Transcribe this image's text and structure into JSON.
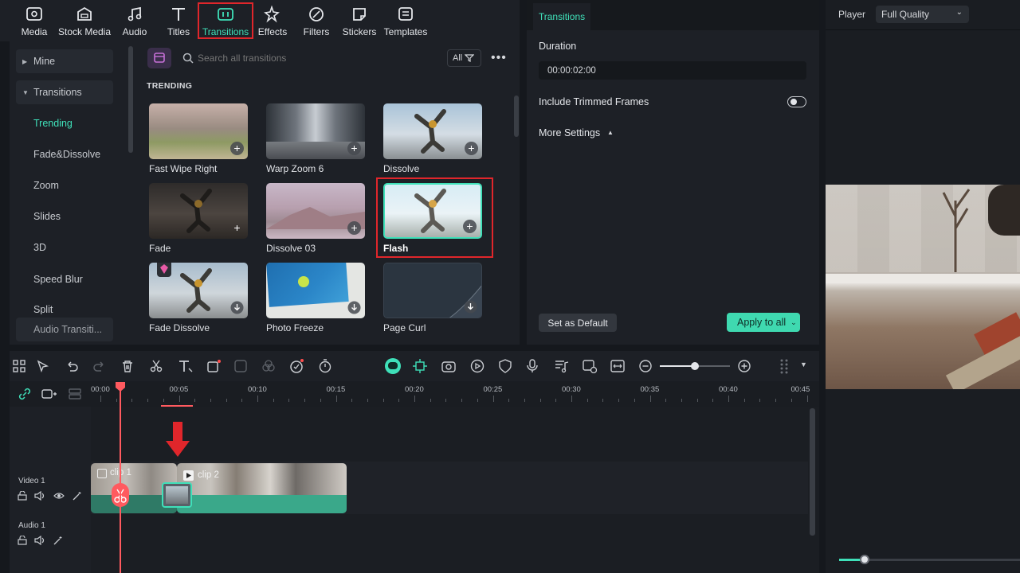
{
  "toolbar": {
    "items": [
      {
        "label": "Media",
        "icon": "media-icon"
      },
      {
        "label": "Stock Media",
        "icon": "stock-media-icon"
      },
      {
        "label": "Audio",
        "icon": "audio-icon"
      },
      {
        "label": "Titles",
        "icon": "titles-icon"
      },
      {
        "label": "Transitions",
        "icon": "transitions-icon",
        "active": true
      },
      {
        "label": "Effects",
        "icon": "effects-icon"
      },
      {
        "label": "Filters",
        "icon": "filters-icon"
      },
      {
        "label": "Stickers",
        "icon": "stickers-icon"
      },
      {
        "label": "Templates",
        "icon": "templates-icon"
      }
    ]
  },
  "sidebar": {
    "mine": "Mine",
    "transitions": "Transitions",
    "items": [
      "Trending",
      "Fade&Dissolve",
      "Zoom",
      "Slides",
      "3D",
      "Speed Blur",
      "Split",
      "Audio Transiti..."
    ]
  },
  "browser": {
    "search_placeholder": "Search all transitions",
    "filter_label": "All",
    "section_title": "TRENDING",
    "items": [
      {
        "label": "Fast Wipe Right"
      },
      {
        "label": "Warp Zoom 6"
      },
      {
        "label": "Dissolve"
      },
      {
        "label": "Fade"
      },
      {
        "label": "Dissolve 03"
      },
      {
        "label": "Flash"
      },
      {
        "label": "Fade Dissolve"
      },
      {
        "label": "Photo Freeze"
      },
      {
        "label": "Page Curl"
      }
    ]
  },
  "properties": {
    "tab": "Transitions",
    "duration_label": "Duration",
    "duration_value": "00:00:02:00",
    "trimmed_label": "Include Trimmed Frames",
    "more_settings": "More Settings",
    "set_default": "Set as Default",
    "apply_all": "Apply to all"
  },
  "player": {
    "label": "Player",
    "quality": "Full Quality"
  },
  "timeline": {
    "ticks": [
      "00:00",
      "00:05",
      "00:10",
      "00:15",
      "00:20",
      "00:25",
      "00:30",
      "00:35",
      "00:40",
      "00:45"
    ],
    "video_track": "Video 1",
    "audio_track": "Audio 1",
    "clip1": "clip 1",
    "clip2": "clip 2"
  },
  "colors": {
    "accent": "#3fe0b9",
    "highlight": "#e0262b",
    "playhead": "#ff5a5f",
    "clip_bar": "#3aa88a"
  }
}
